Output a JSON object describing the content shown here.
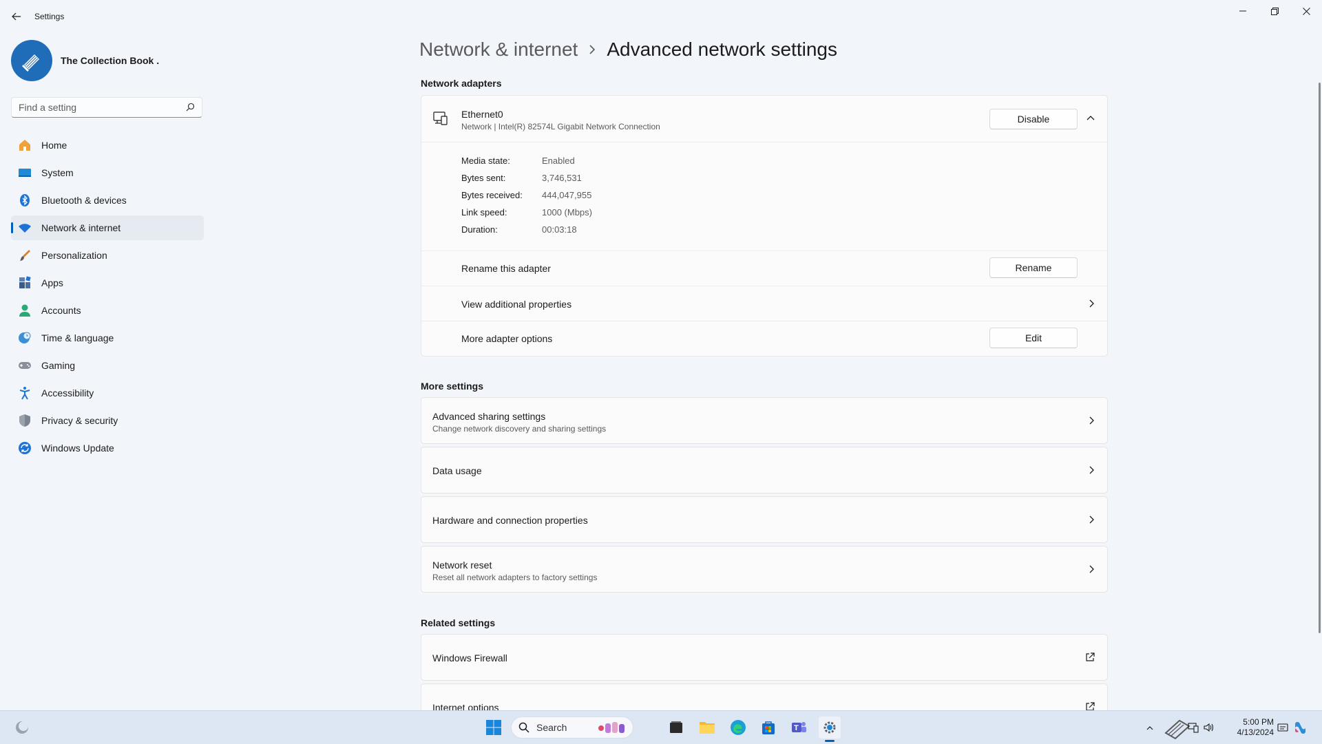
{
  "window": {
    "app_title": "Settings"
  },
  "profile": {
    "name": "The Collection Book ."
  },
  "search": {
    "placeholder": "Find a setting"
  },
  "nav": {
    "items": [
      {
        "label": "Home",
        "icon": "home-icon"
      },
      {
        "label": "System",
        "icon": "system-icon"
      },
      {
        "label": "Bluetooth & devices",
        "icon": "bluetooth-icon"
      },
      {
        "label": "Network & internet",
        "icon": "wifi-icon",
        "active": true
      },
      {
        "label": "Personalization",
        "icon": "brush-icon"
      },
      {
        "label": "Apps",
        "icon": "apps-icon"
      },
      {
        "label": "Accounts",
        "icon": "accounts-icon"
      },
      {
        "label": "Time & language",
        "icon": "globe-clock-icon"
      },
      {
        "label": "Gaming",
        "icon": "gamepad-icon"
      },
      {
        "label": "Accessibility",
        "icon": "accessibility-icon"
      },
      {
        "label": "Privacy & security",
        "icon": "shield-icon"
      },
      {
        "label": "Windows Update",
        "icon": "update-icon"
      }
    ]
  },
  "breadcrumb": {
    "parent": "Network & internet",
    "current": "Advanced network settings"
  },
  "adapters": {
    "section_title": "Network adapters",
    "adapter": {
      "name": "Ethernet0",
      "description": "Network | Intel(R) 82574L Gigabit Network Connection",
      "disable_label": "Disable",
      "properties": [
        {
          "label": "Media state:",
          "value": "Enabled"
        },
        {
          "label": "Bytes sent:",
          "value": "3,746,531"
        },
        {
          "label": "Bytes received:",
          "value": "444,047,955"
        },
        {
          "label": "Link speed:",
          "value": "1000 (Mbps)"
        },
        {
          "label": "Duration:",
          "value": "00:03:18"
        }
      ],
      "rename_label": "Rename this adapter",
      "rename_button": "Rename",
      "view_props_label": "View additional properties",
      "more_options_label": "More adapter options",
      "edit_button": "Edit"
    }
  },
  "more_settings": {
    "section_title": "More settings",
    "items": [
      {
        "title": "Advanced sharing settings",
        "subtitle": "Change network discovery and sharing settings"
      },
      {
        "title": "Data usage"
      },
      {
        "title": "Hardware and connection properties"
      },
      {
        "title": "Network reset",
        "subtitle": "Reset all network adapters to factory settings"
      }
    ]
  },
  "related": {
    "section_title": "Related settings",
    "items": [
      {
        "title": "Windows Firewall"
      },
      {
        "title": "Internet options"
      }
    ]
  },
  "taskbar": {
    "search_label": "Search",
    "time": "5:00 PM",
    "date": "4/13/2024"
  },
  "colors": {
    "accent": "#005fb8",
    "background": "#f2f5fa",
    "card": "#fbfbfb"
  }
}
